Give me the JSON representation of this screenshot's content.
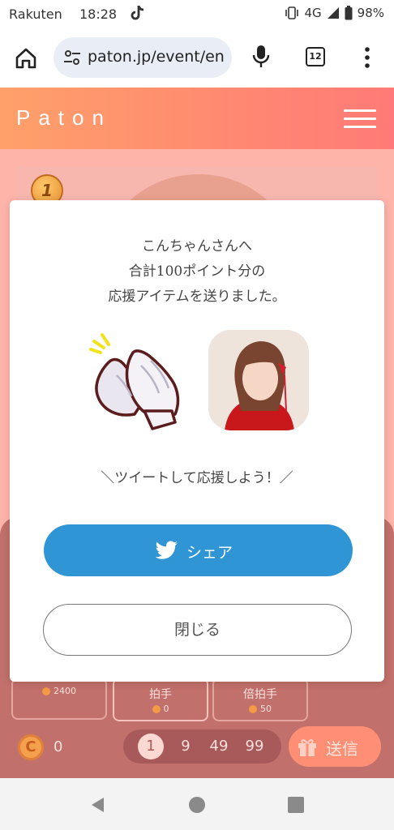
{
  "status_bar": {
    "carrier": "Rakuten",
    "time": "18:28",
    "network": "4G",
    "battery": "98%",
    "icons": [
      "tiktok-icon",
      "vibrate-icon",
      "signal-icon",
      "battery-icon"
    ]
  },
  "browser": {
    "url": "paton.jp/event/en",
    "tab_count": "12",
    "icons": [
      "home-icon",
      "site-settings-icon",
      "mic-icon",
      "tabs-icon",
      "more-menu-icon"
    ]
  },
  "site": {
    "logo": "Paton",
    "rank": "1"
  },
  "items": [
    {
      "name": "",
      "cost": "2400"
    },
    {
      "name": "拍手",
      "cost": "0"
    },
    {
      "name": "倍拍手",
      "cost": "50"
    }
  ],
  "wallet": {
    "coin_symbol": "C",
    "balance": "0"
  },
  "quantity": {
    "options": [
      "1",
      "9",
      "49",
      "99"
    ],
    "selected": "1"
  },
  "send_label": "送信",
  "modal": {
    "message_line1": "こんちゃんさんへ",
    "message_line2": "合計100ポイント分の",
    "message_line3": "応援アイテムを送りました。",
    "tweet_prompt": "＼ツイートして応援しよう！／",
    "share_label": "シェア",
    "close_label": "閉じる"
  },
  "colors": {
    "header_start": "#ffa06a",
    "header_end": "#ff7a78",
    "share_button": "#2f95d4",
    "panel": "#c2706b"
  }
}
